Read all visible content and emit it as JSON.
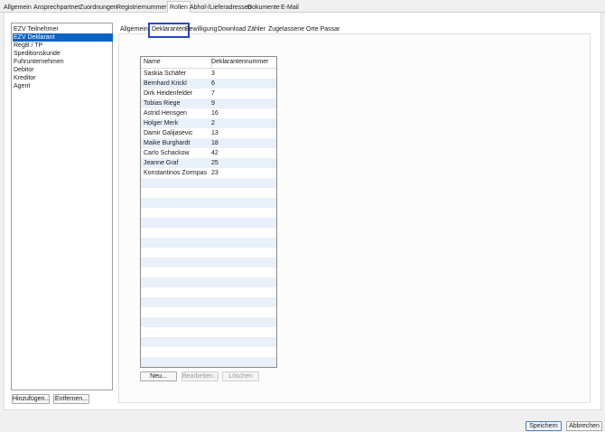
{
  "top_tabs": [
    "Allgemein",
    "Ansprechpartner",
    "Zuordnungen",
    "Registriernummern",
    "Rollen",
    "Abhol-/Lieferadressen",
    "Dokumente",
    "E-Mail"
  ],
  "active_top_tab": "Rollen",
  "roles": [
    "EZV Teilnehmer",
    "EZV Deklarant",
    "RegB / TP",
    "Speditionskunde",
    "Fuhrunternehmen",
    "Debitor",
    "Kreditor",
    "Agent"
  ],
  "selected_role": "EZV Deklarant",
  "role_buttons": {
    "add": "Hinzufügen...",
    "remove": "Entfernen..."
  },
  "inner_tabs": [
    "Allgemein",
    "Deklaranten",
    "Bewilligung",
    "Download",
    "Zähler",
    "Zugelassene Orte Passar"
  ],
  "active_inner_tab": "Deklaranten",
  "table": {
    "columns": [
      "Name",
      "Deklarantennummer"
    ],
    "rows": [
      [
        "Saskia Schäfer",
        "3"
      ],
      [
        "Bernhard Krickl",
        "6"
      ],
      [
        "Dirk Heidenfelder",
        "7"
      ],
      [
        "Tobias Riege",
        "9"
      ],
      [
        "Astrid Hensgen",
        "16"
      ],
      [
        "Holger Merk",
        "2"
      ],
      [
        "Damir Galijasevic",
        "13"
      ],
      [
        "Maike Burghardt",
        "18"
      ],
      [
        "Carlo Schackow",
        "42"
      ],
      [
        "Jeanne Graf",
        "25"
      ],
      [
        "Konstantinos Zormpas",
        "23"
      ]
    ]
  },
  "table_buttons": {
    "new": "Neu...",
    "edit": "Bearbeiten...",
    "delete": "Löschen"
  },
  "footer": {
    "save": "Speichern",
    "cancel": "Abbrechen"
  }
}
